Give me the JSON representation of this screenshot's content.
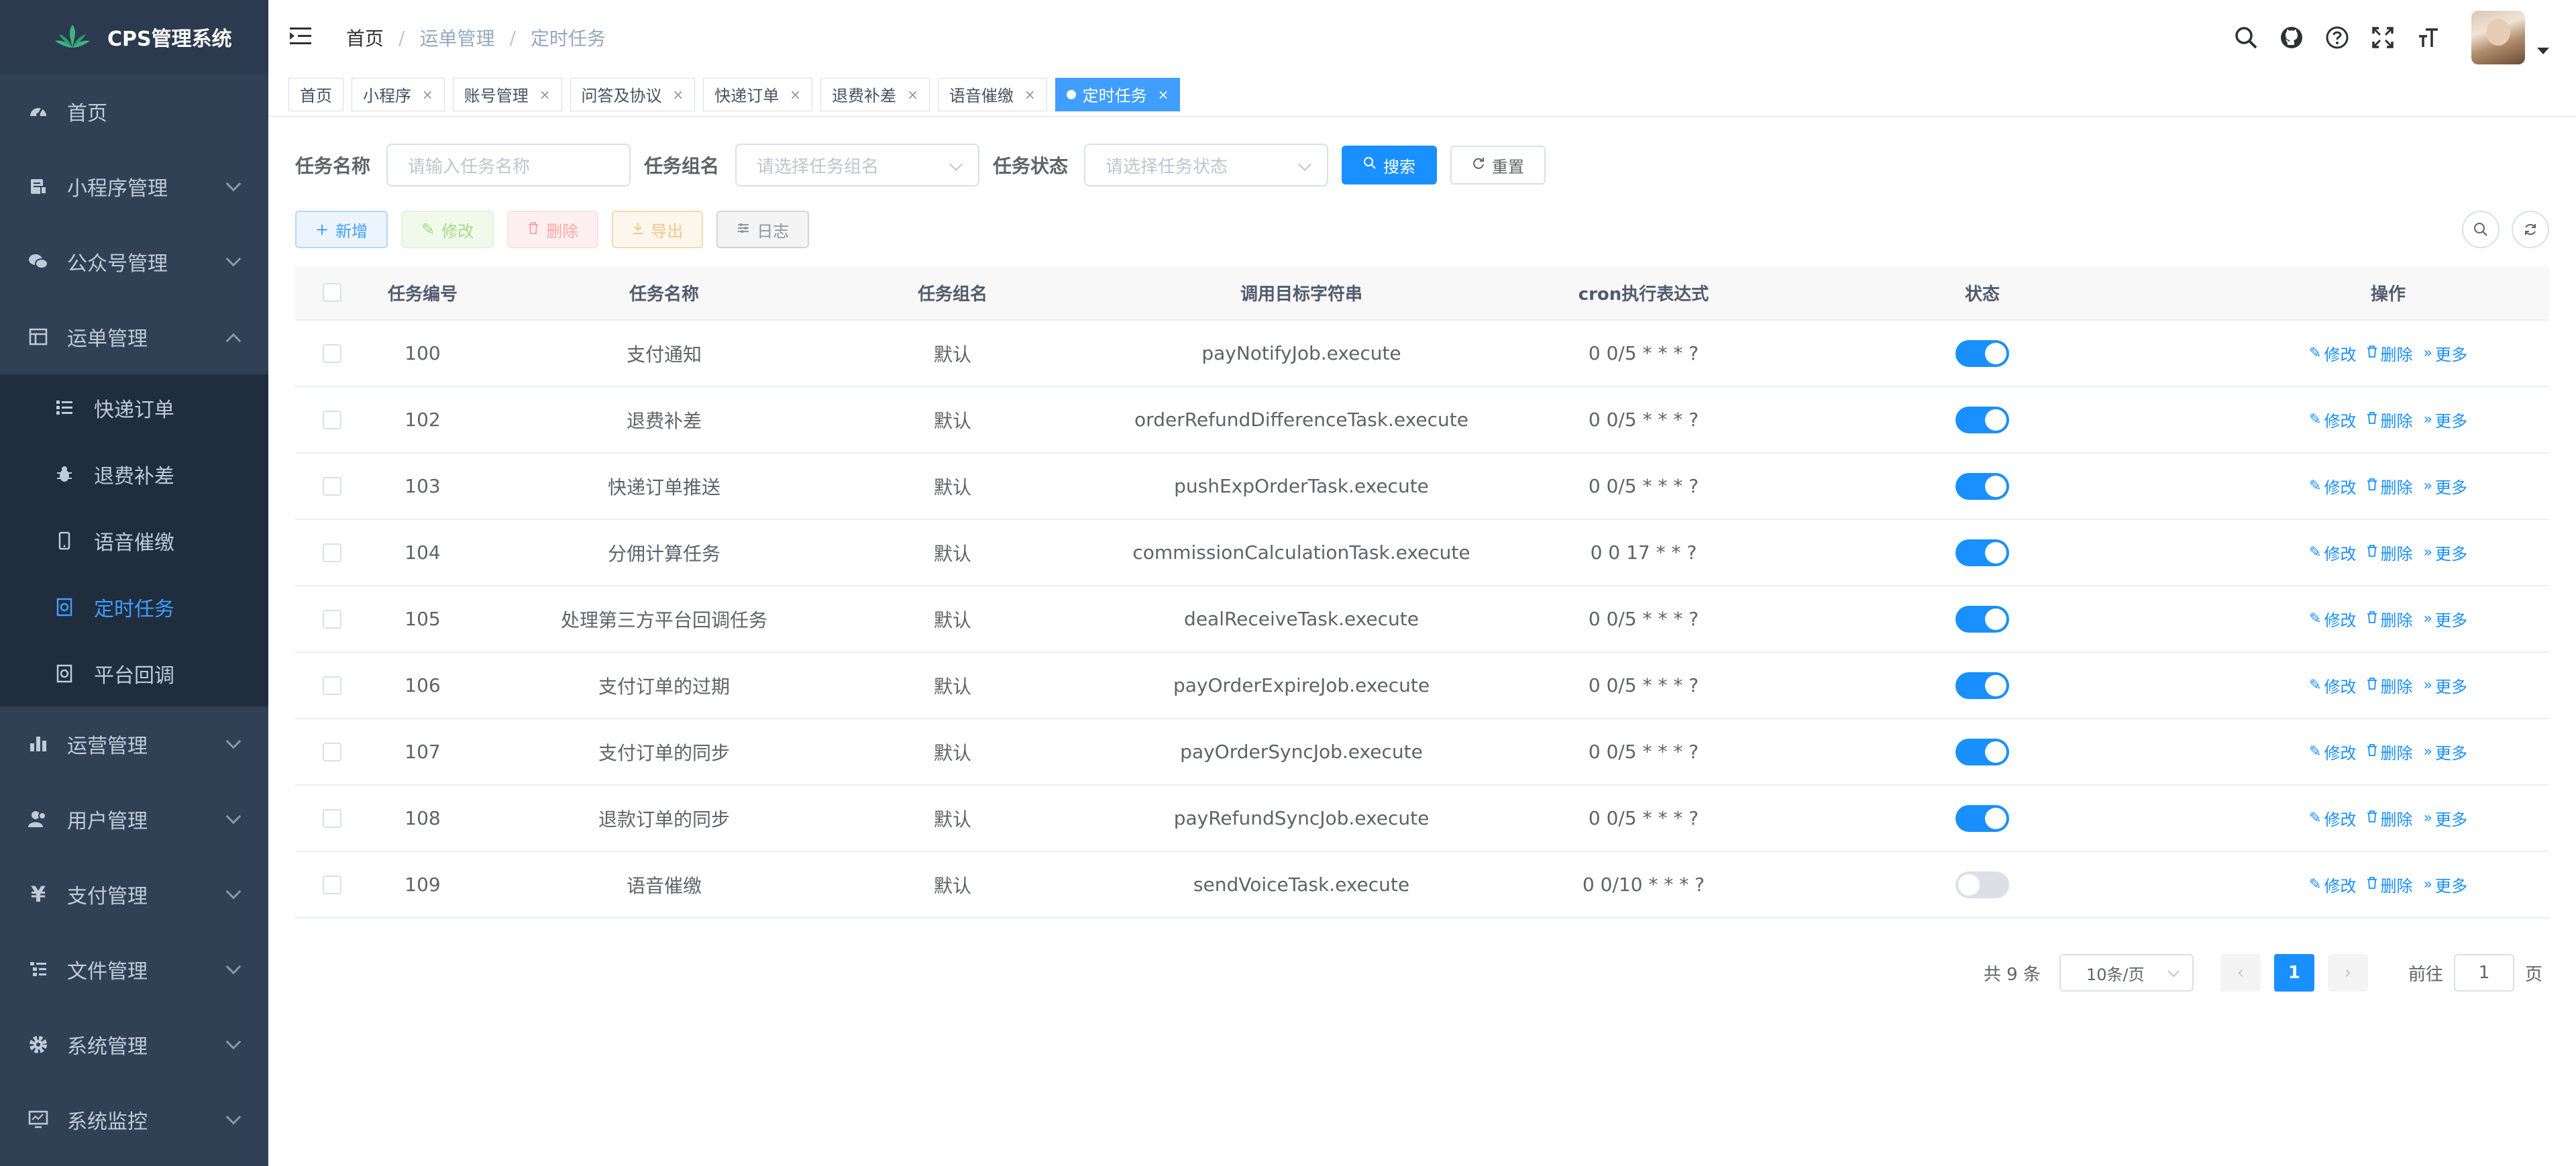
{
  "app": {
    "title": "CPS管理系统"
  },
  "sidebar": {
    "items": [
      {
        "label": "首页",
        "icon": "dashboard-icon"
      },
      {
        "label": "小程序管理",
        "icon": "miniapp-icon"
      },
      {
        "label": "公众号管理",
        "icon": "wechat-icon"
      },
      {
        "label": "运单管理",
        "icon": "table-icon",
        "expanded": true
      },
      {
        "label": "运营管理",
        "icon": "chart-icon"
      },
      {
        "label": "用户管理",
        "icon": "user-icon"
      },
      {
        "label": "支付管理",
        "icon": "yen-icon"
      },
      {
        "label": "文件管理",
        "icon": "tree-icon"
      },
      {
        "label": "系统管理",
        "icon": "gear-icon"
      },
      {
        "label": "系统监控",
        "icon": "monitor-icon"
      }
    ],
    "subitems": [
      {
        "label": "快递订单",
        "icon": "list-icon"
      },
      {
        "label": "退费补差",
        "icon": "bug-icon"
      },
      {
        "label": "语音催缴",
        "icon": "phone-icon"
      },
      {
        "label": "定时任务",
        "icon": "job-icon",
        "active": true
      },
      {
        "label": "平台回调",
        "icon": "job-icon"
      }
    ]
  },
  "header": {
    "breadcrumb": [
      "首页",
      "运单管理",
      "定时任务"
    ]
  },
  "tags": [
    {
      "label": "首页",
      "closable": false
    },
    {
      "label": "小程序",
      "closable": true
    },
    {
      "label": "账号管理",
      "closable": true
    },
    {
      "label": "问答及协议",
      "closable": true
    },
    {
      "label": "快递订单",
      "closable": true
    },
    {
      "label": "退费补差",
      "closable": true
    },
    {
      "label": "语音催缴",
      "closable": true
    },
    {
      "label": "定时任务",
      "closable": true,
      "active": true
    }
  ],
  "search": {
    "name_label": "任务名称",
    "name_placeholder": "请输入任务名称",
    "group_label": "任务组名",
    "group_placeholder": "请选择任务组名",
    "status_label": "任务状态",
    "status_placeholder": "请选择任务状态",
    "search_button": "搜索",
    "reset_button": "重置"
  },
  "toolbar": {
    "add": "新增",
    "edit": "修改",
    "delete": "删除",
    "export": "导出",
    "log": "日志"
  },
  "table": {
    "columns": [
      "任务编号",
      "任务名称",
      "任务组名",
      "调用目标字符串",
      "cron执行表达式",
      "状态",
      "操作"
    ],
    "rows": [
      {
        "id": "100",
        "name": "支付通知",
        "group": "默认",
        "target": "payNotifyJob.execute",
        "cron": "0 0/5 * * * ?",
        "enabled": true
      },
      {
        "id": "102",
        "name": "退费补差",
        "group": "默认",
        "target": "orderRefundDifferenceTask.execute",
        "cron": "0 0/5 * * * ?",
        "enabled": true
      },
      {
        "id": "103",
        "name": "快递订单推送",
        "group": "默认",
        "target": "pushExpOrderTask.execute",
        "cron": "0 0/5 * * * ?",
        "enabled": true
      },
      {
        "id": "104",
        "name": "分佣计算任务",
        "group": "默认",
        "target": "commissionCalculationTask.execute",
        "cron": "0 0 17 * * ?",
        "enabled": true
      },
      {
        "id": "105",
        "name": "处理第三方平台回调任务",
        "group": "默认",
        "target": "dealReceiveTask.execute",
        "cron": "0 0/5 * * * ?",
        "enabled": true
      },
      {
        "id": "106",
        "name": "支付订单的过期",
        "group": "默认",
        "target": "payOrderExpireJob.execute",
        "cron": "0 0/5 * * * ?",
        "enabled": true
      },
      {
        "id": "107",
        "name": "支付订单的同步",
        "group": "默认",
        "target": "payOrderSyncJob.execute",
        "cron": "0 0/5 * * * ?",
        "enabled": true
      },
      {
        "id": "108",
        "name": "退款订单的同步",
        "group": "默认",
        "target": "payRefundSyncJob.execute",
        "cron": "0 0/5 * * * ?",
        "enabled": true
      },
      {
        "id": "109",
        "name": "语音催缴",
        "group": "默认",
        "target": "sendVoiceTask.execute",
        "cron": "0 0/10 * * * ?",
        "enabled": false
      }
    ],
    "ops": {
      "edit": "修改",
      "delete": "删除",
      "more": "更多"
    }
  },
  "pagination": {
    "total": "共 9 条",
    "page_size": "10条/页",
    "current": "1",
    "goto_label": "前往",
    "goto_value": "1",
    "page_suffix": "页"
  },
  "colors": {
    "primary": "#1890ff",
    "sidebar_bg": "#304156",
    "sidebar_active": "#409eff"
  }
}
